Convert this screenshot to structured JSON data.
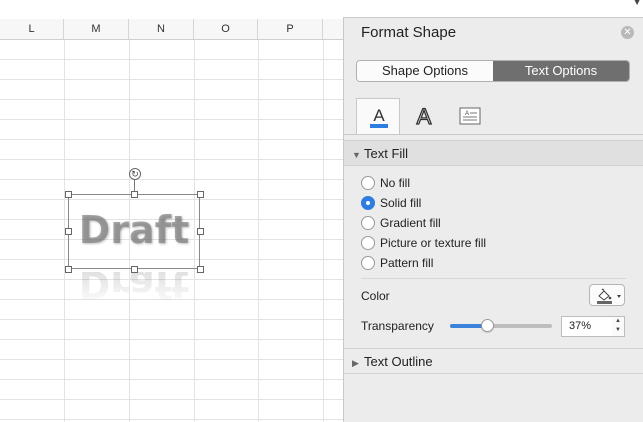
{
  "columns": [
    "L",
    "M",
    "N",
    "O",
    "P"
  ],
  "shape": {
    "text": "Draft",
    "reflection_text": "Draft"
  },
  "panel": {
    "title": "Format Shape",
    "segments": {
      "shape_options": "Shape Options",
      "text_options": "Text Options"
    },
    "tabs": [
      "text-fill-outline",
      "text-effects",
      "textbox"
    ],
    "tab_glyph_fill": "A",
    "tab_glyph_effects": "A",
    "tab_glyph_textbox": "A",
    "sections": {
      "text_fill": "Text Fill",
      "text_outline": "Text Outline"
    },
    "fill_options": [
      "No fill",
      "Solid fill",
      "Gradient fill",
      "Picture or texture fill",
      "Pattern fill"
    ],
    "selected_fill": "Solid fill",
    "color_label": "Color",
    "transparency_label": "Transparency",
    "transparency_value": "37%",
    "transparency_fraction": 0.37
  },
  "colors": {
    "accent": "#2f7de1",
    "segment_active": "#6f6f6f",
    "text_fill": "#7a7a7a"
  }
}
